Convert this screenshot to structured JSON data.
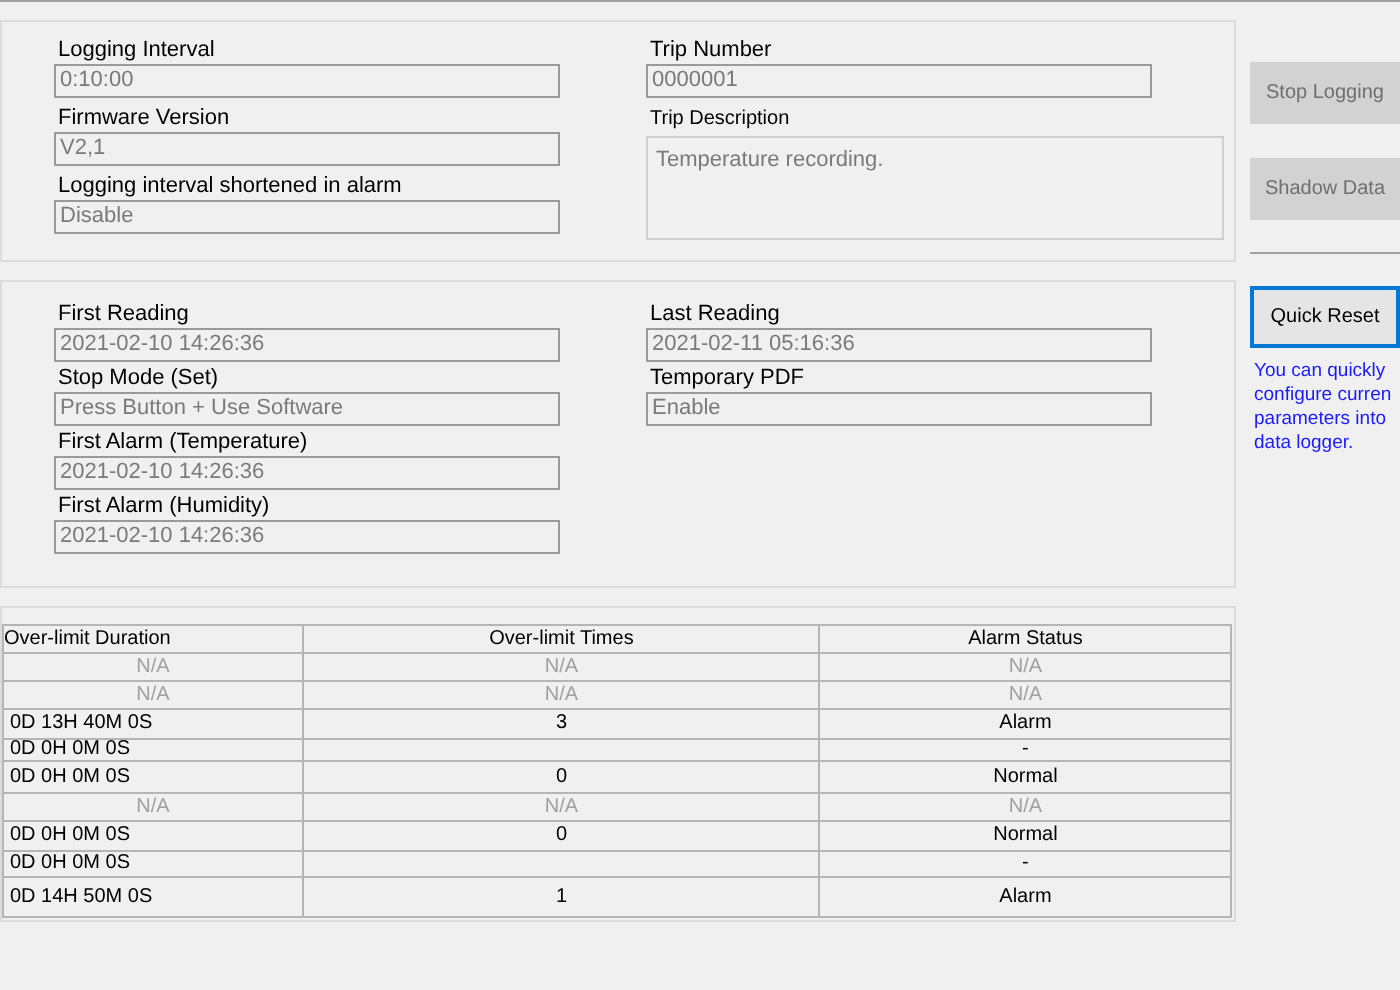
{
  "settings": {
    "left": [
      {
        "label": "Logging Interval",
        "value": "0:10:00"
      },
      {
        "label": "Firmware Version",
        "value": "V2,1"
      },
      {
        "label": "Logging interval shortened in alarm",
        "value": "Disable"
      }
    ],
    "trip_number": {
      "label": "Trip Number",
      "value": "0000001"
    },
    "trip_description": {
      "label": "Trip Description",
      "value": "Temperature recording."
    }
  },
  "readings": {
    "left": [
      {
        "label": "First Reading",
        "value": "2021-02-10 14:26:36"
      },
      {
        "label": "Stop Mode (Set)",
        "value": "Press Button  + Use Software"
      },
      {
        "label": "First Alarm (Temperature)",
        "value": "2021-02-10 14:26:36"
      },
      {
        "label": "First Alarm (Humidity)",
        "value": "2021-02-10 14:26:36"
      }
    ],
    "right": [
      {
        "label": "Last Reading",
        "value": "2021-02-11 05:16:36"
      },
      {
        "label": "Temporary PDF",
        "value": "Enable"
      }
    ]
  },
  "table": {
    "columns": [
      "Over-limit Duration",
      "Over-limit Times",
      "Alarm Status"
    ],
    "rows": [
      {
        "duration": "N/A",
        "times": "N/A",
        "status": "N/A",
        "disabled": true
      },
      {
        "duration": "N/A",
        "times": "N/A",
        "status": "N/A",
        "disabled": true
      },
      {
        "duration": "0D 13H 40M 0S",
        "times": "3",
        "status": "Alarm",
        "disabled": false
      },
      {
        "duration": "0D 0H 0M 0S",
        "status": "-",
        "disabled": false
      },
      {
        "duration": "0D 0H 0M 0S",
        "times": "0",
        "status": "Normal",
        "disabled": false
      },
      {
        "duration": "N/A",
        "times": "N/A",
        "status": "N/A",
        "disabled": true
      },
      {
        "duration": "0D 0H 0M 0S",
        "times": "0",
        "status": "Normal",
        "disabled": false
      },
      {
        "duration": "0D 0H 0M 0S",
        "status": "-",
        "disabled": false
      },
      {
        "duration": "0D 14H 50M 0S",
        "times": "1",
        "status": "Alarm",
        "disabled": false
      }
    ]
  },
  "side": {
    "buttons": [
      {
        "label": "Stop Logging",
        "disabled": true
      },
      {
        "label": "Shadow Data",
        "disabled": true
      }
    ],
    "reset_button": {
      "label": "Quick Reset",
      "disabled": false
    },
    "hint_lines": [
      "You can quickly",
      "configure curren",
      "parameters into",
      "data logger."
    ]
  }
}
